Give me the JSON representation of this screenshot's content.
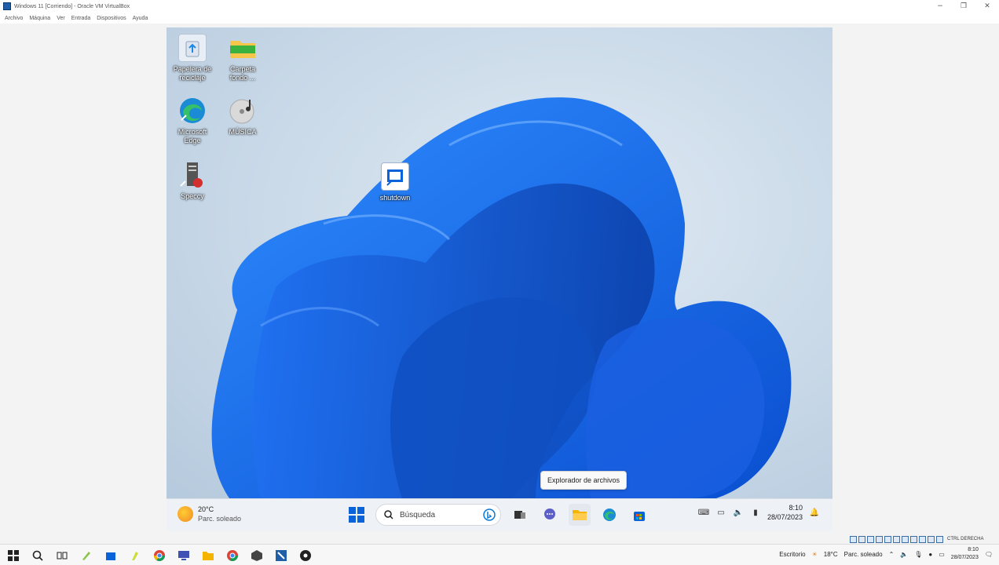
{
  "window": {
    "title": "Windows 11 [Corriendo] - Oracle VM VirtualBox",
    "controls": {
      "minimize": "−",
      "maximize": "❐",
      "close": "✕"
    }
  },
  "menubar": [
    "Archivo",
    "Máquina",
    "Ver",
    "Entrada",
    "Dispositivos",
    "Ayuda"
  ],
  "desktop": {
    "icons": [
      {
        "name": "recycle-bin",
        "label": "Papelera de\nreciclaje"
      },
      {
        "name": "folder-carpeta",
        "label": "Carpeta\nfondo ..."
      },
      {
        "name": "edge",
        "label": "Microsoft\nEdge"
      },
      {
        "name": "music",
        "label": "MÚSICA"
      },
      {
        "name": "speccy",
        "label": "Speccy"
      },
      {
        "name": "shutdown",
        "label": "shutdown"
      }
    ],
    "tooltip": "Explorador de archivos"
  },
  "vm_taskbar": {
    "weather_temp": "20°C",
    "weather_desc": "Parc. soleado",
    "search_placeholder": "Búsqueda",
    "time": "8:10",
    "date": "28/07/2023"
  },
  "host_status": {
    "hotkey": "CTRL DERECHA"
  },
  "host_taskbar": {
    "desktop_label": "Escritorio",
    "weather_temp": "18°C",
    "weather_desc": "Parc. soleado",
    "time": "8:10",
    "date": "28/07/2023"
  },
  "colors": {
    "accent": "#0a63d8",
    "wallpaper_bg": "#c9d9e8"
  }
}
